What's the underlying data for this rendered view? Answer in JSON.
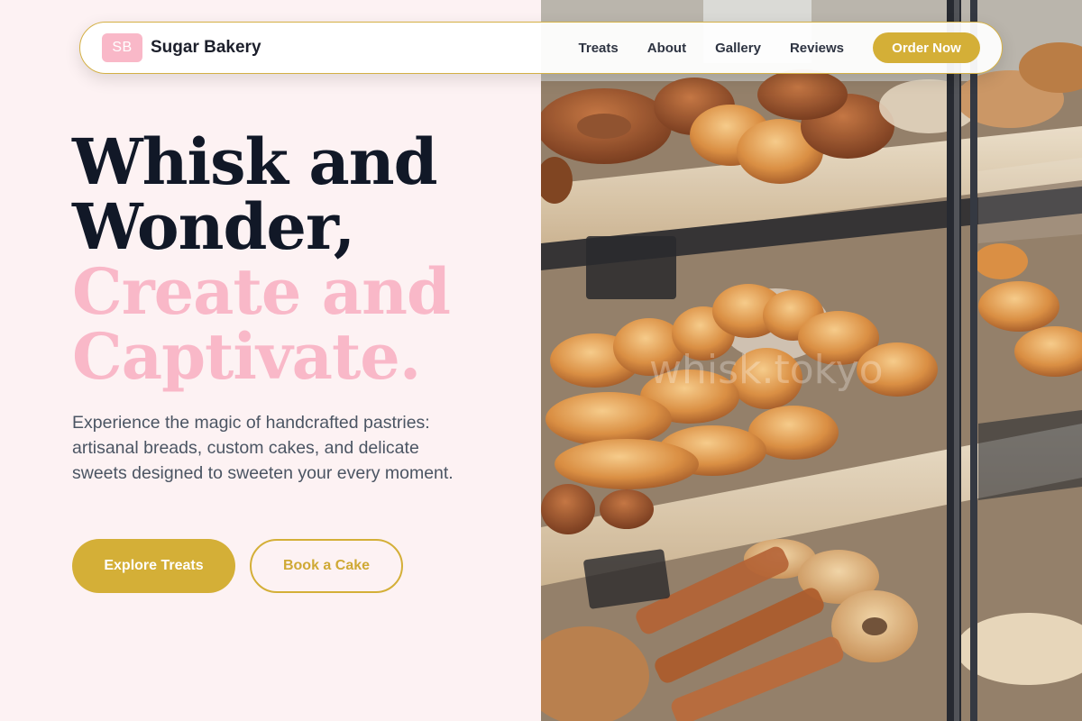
{
  "nav": {
    "logo_initials": "SB",
    "brand": "Sugar Bakery",
    "links": [
      "Treats",
      "About",
      "Gallery",
      "Reviews"
    ],
    "cta": "Order Now"
  },
  "hero": {
    "headline_line1": "Whisk and",
    "headline_line2": "Wonder,",
    "headline_line3": "Create and",
    "headline_line4": "Captivate.",
    "description": "Experience the magic of handcrafted pastries: artisanal breads, custom cakes, and delicate sweets designed to sweeten your every moment.",
    "primary_button": "Explore Treats",
    "secondary_button": "Book a Cake"
  },
  "photo": {
    "watermark": "whisk.tokyo",
    "icon": "bakery-display-case-image"
  },
  "colors": {
    "background": "#fdf2f3",
    "accent_gold": "#d4af37",
    "accent_pink": "#f9b8c8",
    "heading_dark": "#111827"
  }
}
